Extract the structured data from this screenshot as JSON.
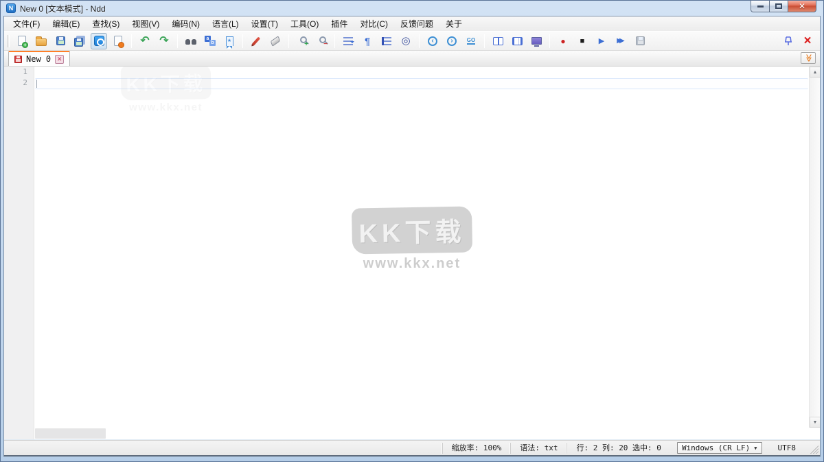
{
  "window": {
    "title": "New 0 [文本模式] - Ndd"
  },
  "menu": {
    "items": [
      "文件(F)",
      "编辑(E)",
      "查找(S)",
      "视图(V)",
      "编码(N)",
      "语言(L)",
      "设置(T)",
      "工具(O)",
      "插件",
      "对比(C)",
      "反馈问题",
      "关于"
    ]
  },
  "toolbar": {
    "icons": [
      "new-file",
      "open-file",
      "save-file",
      "save-all",
      "auto-save-toggle",
      "close-file",
      "undo",
      "redo",
      "find",
      "replace",
      "bookmark",
      "mark-pen",
      "erase-mark",
      "zoom-in",
      "zoom-out",
      "word-wrap",
      "show-symbols",
      "indent-guide",
      "focus-mode",
      "nav-back",
      "nav-forward",
      "goto-line",
      "split-view",
      "split-view-vertical",
      "fullscreen",
      "macro-record",
      "macro-stop",
      "macro-play",
      "macro-play-multiple",
      "macro-save",
      "pin-toolbar",
      "close-toolbar"
    ],
    "goto_label": "GO"
  },
  "glyphs": {
    "undo": "↶",
    "redo": "↷",
    "paragraph": "¶",
    "focus": "◎",
    "back": "‹",
    "forward": "›",
    "record": "●",
    "stop": "■",
    "play": "▶",
    "play_multi": "▶▶",
    "close_x": "×",
    "tab_close": "✕",
    "chevron_double": "≫",
    "dropdown_arrow": "▼",
    "scroll_up": "▲",
    "scroll_down": "▼",
    "zoom_plus": "+",
    "zoom_minus": "−",
    "app_initial": "N"
  },
  "tabs": {
    "active_label": "New 0"
  },
  "editor": {
    "line_numbers": [
      "1",
      "2"
    ],
    "watermark_title": "KK下载",
    "watermark_url": "www.kkx.net"
  },
  "status": {
    "zoom_label": "缩放率: 100%",
    "syntax_label": "语法: txt",
    "caret_label": "行: 2 列: 20 选中: 0",
    "eol_label": "Windows (CR LF)",
    "encoding_label": "UTF8"
  }
}
